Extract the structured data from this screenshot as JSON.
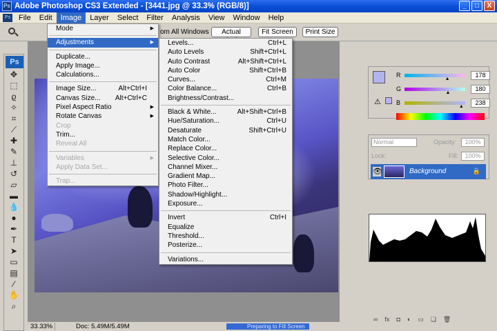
{
  "window": {
    "title": "Adobe Photoshop CS3 Extended - [3441.jpg @ 33.3% (RGB/8)]",
    "app_icon": "Ps",
    "controls": [
      "_",
      "□",
      "X"
    ]
  },
  "menubar": {
    "doc_icon": "Ps",
    "items": [
      "File",
      "Edit",
      "Image",
      "Layer",
      "Select",
      "Filter",
      "Analysis",
      "View",
      "Window",
      "Help"
    ]
  },
  "options": {
    "all_windows": "om All Windows",
    "actual_pixels": "Actual Pixels",
    "fit_screen": "Fit Screen",
    "print_size": "Print Size"
  },
  "toolbox": {
    "logo": "Ps",
    "tools": [
      "move-icon",
      "marquee-icon",
      "lasso-icon",
      "magic-wand-icon",
      "crop-icon",
      "slice-icon",
      "healing-icon",
      "brush-icon",
      "clone-stamp-icon",
      "history-brush-icon",
      "eraser-icon",
      "gradient-icon",
      "blur-icon",
      "dodge-icon",
      "pen-icon",
      "type-icon",
      "path-select-icon",
      "shape-icon",
      "notes-icon",
      "eyedropper-icon",
      "hand-icon",
      "zoom-icon"
    ]
  },
  "image_menu": {
    "items": [
      {
        "label": "Mode",
        "shortcut": "",
        "submenu": true,
        "state": "normal"
      },
      {
        "sep": true
      },
      {
        "label": "Adjustments",
        "shortcut": "",
        "submenu": true,
        "state": "highlight"
      },
      {
        "sep": true
      },
      {
        "label": "Duplicate...",
        "shortcut": "",
        "submenu": false,
        "state": "normal"
      },
      {
        "label": "Apply Image...",
        "shortcut": "",
        "submenu": false,
        "state": "normal"
      },
      {
        "label": "Calculations...",
        "shortcut": "",
        "submenu": false,
        "state": "normal"
      },
      {
        "sep": true
      },
      {
        "label": "Image Size...",
        "shortcut": "Alt+Ctrl+I",
        "submenu": false,
        "state": "normal"
      },
      {
        "label": "Canvas Size...",
        "shortcut": "Alt+Ctrl+C",
        "submenu": false,
        "state": "normal"
      },
      {
        "label": "Pixel Aspect Ratio",
        "shortcut": "",
        "submenu": true,
        "state": "normal"
      },
      {
        "label": "Rotate Canvas",
        "shortcut": "",
        "submenu": true,
        "state": "normal"
      },
      {
        "label": "Crop",
        "shortcut": "",
        "submenu": false,
        "state": "disabled"
      },
      {
        "label": "Trim...",
        "shortcut": "",
        "submenu": false,
        "state": "normal"
      },
      {
        "label": "Reveal All",
        "shortcut": "",
        "submenu": false,
        "state": "disabled"
      },
      {
        "sep": true
      },
      {
        "label": "Variables",
        "shortcut": "",
        "submenu": true,
        "state": "disabled"
      },
      {
        "label": "Apply Data Set...",
        "shortcut": "",
        "submenu": false,
        "state": "disabled"
      },
      {
        "sep": true
      },
      {
        "label": "Trap...",
        "shortcut": "",
        "submenu": false,
        "state": "disabled"
      }
    ]
  },
  "adjustments_menu": {
    "items": [
      {
        "label": "Levels...",
        "shortcut": "Ctrl+L"
      },
      {
        "label": "Auto Levels",
        "shortcut": "Shift+Ctrl+L"
      },
      {
        "label": "Auto Contrast",
        "shortcut": "Alt+Shift+Ctrl+L"
      },
      {
        "label": "Auto Color",
        "shortcut": "Shift+Ctrl+B"
      },
      {
        "label": "Curves...",
        "shortcut": "Ctrl+M"
      },
      {
        "label": "Color Balance...",
        "shortcut": "Ctrl+B"
      },
      {
        "label": "Brightness/Contrast...",
        "shortcut": ""
      },
      {
        "sep": true
      },
      {
        "label": "Black & White...",
        "shortcut": "Alt+Shift+Ctrl+B"
      },
      {
        "label": "Hue/Saturation...",
        "shortcut": "Ctrl+U"
      },
      {
        "label": "Desaturate",
        "shortcut": "Shift+Ctrl+U"
      },
      {
        "label": "Match Color...",
        "shortcut": ""
      },
      {
        "label": "Replace Color...",
        "shortcut": ""
      },
      {
        "label": "Selective Color...",
        "shortcut": ""
      },
      {
        "label": "Channel Mixer...",
        "shortcut": ""
      },
      {
        "label": "Gradient Map...",
        "shortcut": ""
      },
      {
        "label": "Photo Filter...",
        "shortcut": ""
      },
      {
        "label": "Shadow/Highlight...",
        "shortcut": ""
      },
      {
        "label": "Exposure...",
        "shortcut": ""
      },
      {
        "sep": true
      },
      {
        "label": "Invert",
        "shortcut": "Ctrl+I"
      },
      {
        "label": "Equalize",
        "shortcut": ""
      },
      {
        "label": "Threshold...",
        "shortcut": ""
      },
      {
        "label": "Posterize...",
        "shortcut": ""
      },
      {
        "sep": true
      },
      {
        "label": "Variations...",
        "shortcut": ""
      }
    ]
  },
  "color_panel": {
    "channels": [
      {
        "label": "R",
        "value": "178",
        "track": "linear-gradient(to right,#00b4ee,#ffb4ee)",
        "fraction": 0.7
      },
      {
        "label": "G",
        "value": "180",
        "track": "linear-gradient(to right,#b200ee,#b2ffee)",
        "fraction": 0.71
      },
      {
        "label": "B",
        "value": "238",
        "track": "linear-gradient(to right,#b2b400,#b2b4ff)",
        "fraction": 0.93
      }
    ],
    "foreground": "#b2b4ee"
  },
  "layers_panel": {
    "blend_mode": "Normal",
    "opacity_label": "Opacity:",
    "opacity_value": "100%",
    "lock_label": "Lock:",
    "fill_label": "Fill:",
    "fill_value": "100%",
    "layer_name": "Background"
  },
  "status": {
    "zoom": "33.33%",
    "doc": "Doc: 5.49M/5.49M",
    "bar_text": "Preparing to Fill Screen"
  }
}
